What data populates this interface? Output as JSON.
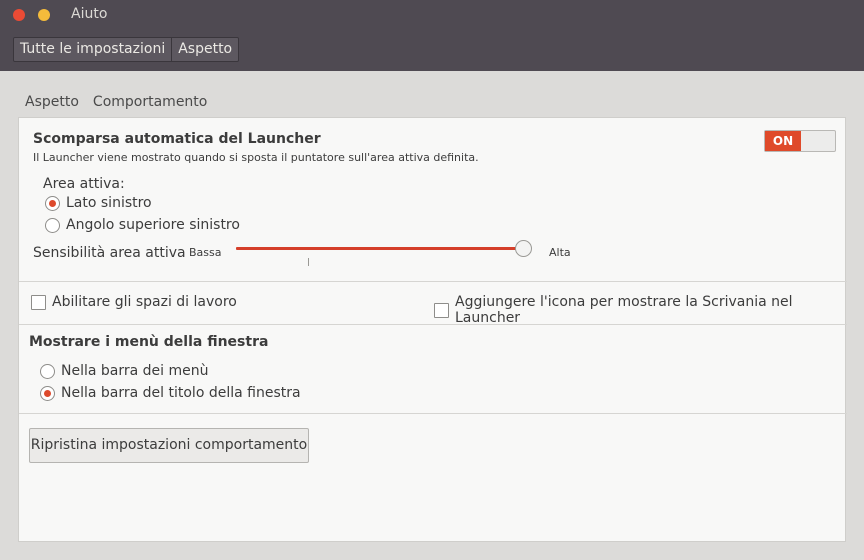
{
  "window": {
    "title": "Aiuto",
    "breadcrumbs": [
      "Tutte le impostazioni",
      "Aspetto"
    ]
  },
  "tabs": [
    "Aspetto",
    "Comportamento"
  ],
  "launcher": {
    "heading": "Scomparsa automatica del Launcher",
    "description": "Il Launcher viene mostrato quando si sposta il puntatore sull'area attiva definita.",
    "toggle_label": "ON",
    "toggle_state": true,
    "active_area_label": "Area attiva:",
    "options": [
      {
        "label": "Lato sinistro",
        "checked": true
      },
      {
        "label": "Angolo superiore sinistro",
        "checked": false
      }
    ],
    "sensitivity_label": "Sensibilità area attiva",
    "sensitivity_low": "Bassa",
    "sensitivity_high": "Alta",
    "sensitivity_value": 0.9
  },
  "workspaces": {
    "enable_label": "Abilitare gli spazi di lavoro",
    "enable_checked": false,
    "desktop_icon_label": "Aggiungere l'icona per mostrare la Scrivania nel Launcher",
    "desktop_icon_checked": false
  },
  "menus": {
    "heading": "Mostrare i menù della finestra",
    "options": [
      {
        "label": "Nella barra dei menù",
        "checked": false
      },
      {
        "label": "Nella barra del titolo della finestra",
        "checked": true
      }
    ]
  },
  "reset_button": "Ripristina impostazioni comportamento",
  "colors": {
    "accent": "#dd4a2d",
    "titlebar": "#4f4a52"
  }
}
